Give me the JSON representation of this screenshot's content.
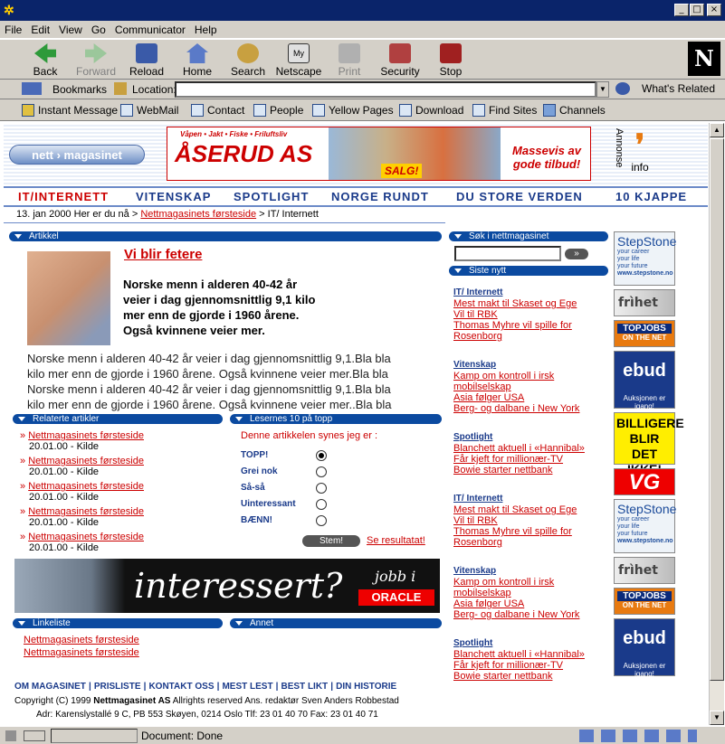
{
  "menu": [
    "File",
    "Edit",
    "View",
    "Go",
    "Communicator",
    "Help"
  ],
  "toolbar": [
    "Back",
    "Forward",
    "Reload",
    "Home",
    "Search",
    "Netscape",
    "Print",
    "Security",
    "Stop"
  ],
  "location": {
    "bookmarks": "Bookmarks",
    "label": "Location:",
    "value": "",
    "related": "What's Related"
  },
  "personal": [
    "Instant Message",
    "WebMail",
    "Contact",
    "People",
    "Yellow Pages",
    "Download",
    "Find Sites",
    "Channels"
  ],
  "site": {
    "logo": "nett › magasinet",
    "ad_brand": "ÅSERUD AS",
    "ad_tag": "Våpen • Jakt • Fiske • Friluftsliv",
    "ad_text": "Massevis av gode tilbud!",
    "ad_sale": "SALG!",
    "annonse": "Annonse",
    "info": "info"
  },
  "nav": [
    "IT/INTERNETT",
    "VITENSKAP",
    "SPOTLIGHT",
    "NORGE RUNDT",
    "DU STORE VERDEN",
    "10 KJAPPE"
  ],
  "breadcrumb": {
    "date": "13. jan 2000",
    "here": "Her er du nå >",
    "link": "Nettmagasinets førsteside",
    "rest": "> IT/ Internett"
  },
  "article": {
    "bar": "Artikkel",
    "title": "Vi blir fetere",
    "lead": "Norske menn i alderen 40-42 år veier i dag gjennomsnittlig 9,1 kilo mer enn de gjorde i 1960 årene. Også kvinnene veier mer.",
    "body": [
      "Norske menn i alderen 40-42 år veier i dag gjennomsnittlig 9,1.Bla bla",
      "kilo mer enn de gjorde i 1960 årene. Også kvinnene veier mer.Bla bla",
      "Norske menn i alderen 40-42 år veier i dag gjennomsnittlig 9,1.Bla bla",
      "kilo mer enn de gjorde i 1960 årene. Også kvinnene veier mer..Bla bla"
    ]
  },
  "related": {
    "bar": "Relaterte artikler",
    "items": [
      {
        "t": "Nettmagasinets førsteside",
        "d": "20.01.00 - Kilde"
      },
      {
        "t": "Nettmagasinets førsteside",
        "d": "20.01.00 - Kilde"
      },
      {
        "t": "Nettmagasinets førsteside",
        "d": "20.01.00 - Kilde"
      },
      {
        "t": "Nettmagasinets førsteside",
        "d": "20.01.00 - Kilde"
      },
      {
        "t": "Nettmagasinets førsteside",
        "d": "20.01.00 - Kilde"
      }
    ]
  },
  "poll": {
    "bar": "Lesernes 10 på topp",
    "question": "Denne artikkelen synes jeg er :",
    "options": [
      "TOPP!",
      "Grei nok",
      "Så-så",
      "Uinteressant",
      "BÆNN!"
    ],
    "vote": "Stem!",
    "results": "Se resultatat!"
  },
  "banner": {
    "text": "interessert?",
    "jobb": "jobb i",
    "oracle": "ORACLE"
  },
  "links": {
    "bar": "Linkeliste",
    "items": [
      "Nettmagasinets førsteside",
      "Nettmagasinets førsteside"
    ]
  },
  "annet": {
    "bar": "Annet"
  },
  "footer": {
    "links": [
      "OM MAGASINET",
      "PRISLISTE",
      "KONTAKT OSS",
      "MEST LEST",
      "BEST LIKT",
      "DIN HISTORIE"
    ],
    "copyright": "Copyright (C) 1999",
    "company": "Nettmagasinet AS",
    "rights": "Allrights reserved Ans. redaktør Sven Anders Robbestad",
    "address": "Adr: Karenslystallé 9 C, PB 553 Skøyen, 0214 Oslo Tlf: 23 01 40 70 Fax: 23 01 40 71"
  },
  "search": {
    "bar": "Søk i nettmagasinet",
    "go": "»"
  },
  "latest": {
    "bar": "Siste nytt",
    "groups": [
      {
        "h": "IT/ Internett",
        "items": [
          "Mest makt til Skaset og Ege",
          "Vil til RBK",
          "Thomas Myhre vil spille for",
          "Rosenborg"
        ]
      },
      {
        "h": "Vitenskap",
        "items": [
          "Kamp om kontroll i irsk",
          "mobilselskap",
          "Asia følger USA",
          "Berg- og dalbane i New York"
        ]
      },
      {
        "h": "Spotlight",
        "items": [
          "Blanchett aktuell i «Hannibal»",
          "Får kjeft for millionær-TV",
          "Bowie starter nettbank"
        ]
      },
      {
        "h": "IT/ Internett",
        "items": [
          "Mest makt til Skaset og Ege",
          "Vil til RBK",
          "Thomas Myhre vil spille for",
          "Rosenborg"
        ]
      },
      {
        "h": "Vitenskap",
        "items": [
          "Kamp om kontroll i irsk",
          "mobilselskap",
          "Asia følger USA",
          "Berg- og dalbane i New York"
        ]
      },
      {
        "h": "Spotlight",
        "items": [
          "Blanchett aktuell i «Hannibal»",
          "Får kjeft for millionær-TV",
          "Bowie starter nettbank"
        ]
      }
    ]
  },
  "ads": {
    "stepstone": "StepStone",
    "stepstone_sub": "your career your life your future",
    "stepstone_url": "www.stepstone.no",
    "frihet": "frìhet",
    "topjobs": "TOPJOBS",
    "topjobs_sub": "ON THE NET",
    "ebud": "ebud",
    "ebud_sub": "Auksjonen er igang!",
    "billigere": "BILLIGERE BLIR DET IKKE!",
    "vg": "VG"
  },
  "status": {
    "text": "Document: Done"
  }
}
